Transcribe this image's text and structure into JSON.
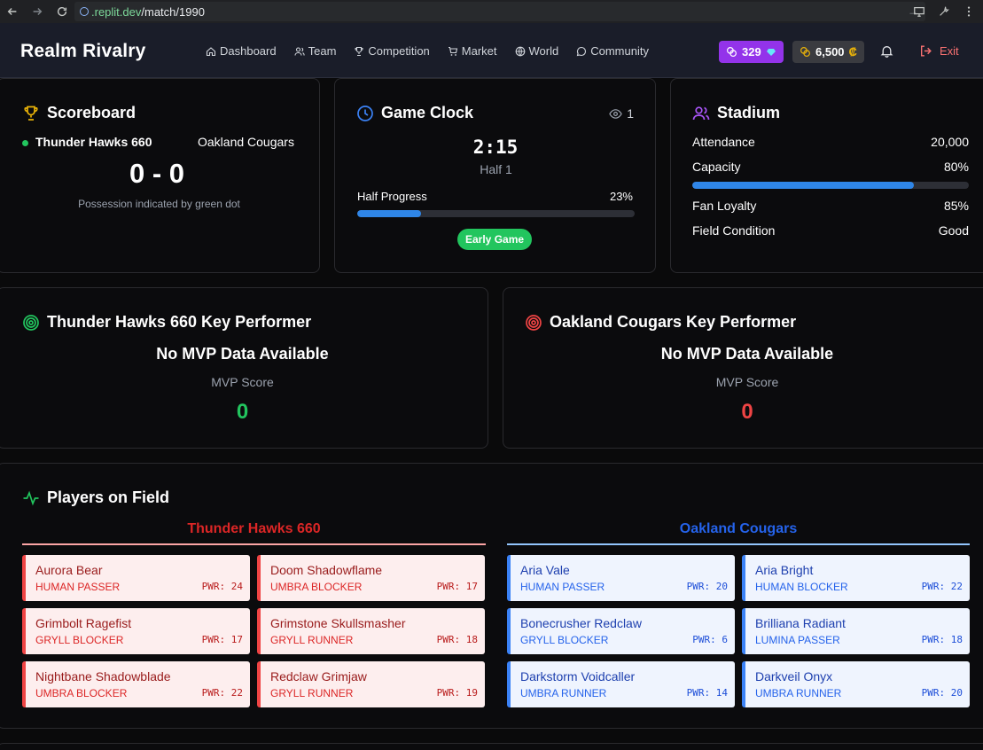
{
  "browser": {
    "url_host": ".replit.dev",
    "url_path": "/match/1990"
  },
  "header": {
    "brand": "Realm Rivalry",
    "nav": [
      "Dashboard",
      "Team",
      "Competition",
      "Market",
      "World",
      "Community"
    ],
    "gems": "329",
    "coins": "6,500",
    "exit_label": "Exit"
  },
  "scoreboard": {
    "title": "Scoreboard",
    "home_team": "Thunder Hawks 660",
    "away_team": "Oakland Cougars",
    "score": "0 - 0",
    "note": "Possession indicated by green dot"
  },
  "clock": {
    "title": "Game Clock",
    "viewers": "1",
    "time": "2:15",
    "half": "Half 1",
    "progress_label": "Half Progress",
    "progress_text": "23%",
    "progress_value": 0.23,
    "phase": "Early Game"
  },
  "stadium": {
    "title": "Stadium",
    "attendance_label": "Attendance",
    "attendance": "20,000",
    "capacity_label": "Capacity",
    "capacity": "80%",
    "capacity_value": 0.8,
    "loyalty_label": "Fan Loyalty",
    "loyalty": "85%",
    "field_label": "Field Condition",
    "field": "Good"
  },
  "performers": {
    "home_title": "Thunder Hawks 660 Key Performer",
    "away_title": "Oakland Cougars Key Performer",
    "none_text": "No MVP Data Available",
    "score_label": "MVP Score",
    "home_score": "0",
    "away_score": "0"
  },
  "field": {
    "title": "Players on Field",
    "home_name": "Thunder Hawks 660",
    "away_name": "Oakland Cougars",
    "home_players": [
      {
        "name": "Aurora Bear",
        "role": "HUMAN PASSER",
        "pwr": "PWR: 24"
      },
      {
        "name": "Doom Shadowflame",
        "role": "UMBRA BLOCKER",
        "pwr": "PWR: 17"
      },
      {
        "name": "Grimbolt Ragefist",
        "role": "GRYLL BLOCKER",
        "pwr": "PWR: 17"
      },
      {
        "name": "Grimstone Skullsmasher",
        "role": "GRYLL RUNNER",
        "pwr": "PWR: 18"
      },
      {
        "name": "Nightbane Shadowblade",
        "role": "UMBRA BLOCKER",
        "pwr": "PWR: 22"
      },
      {
        "name": "Redclaw Grimjaw",
        "role": "GRYLL RUNNER",
        "pwr": "PWR: 19"
      }
    ],
    "away_players": [
      {
        "name": "Aria Vale",
        "role": "HUMAN PASSER",
        "pwr": "PWR: 20"
      },
      {
        "name": "Aria Bright",
        "role": "HUMAN BLOCKER",
        "pwr": "PWR: 22"
      },
      {
        "name": "Bonecrusher Redclaw",
        "role": "GRYLL BLOCKER",
        "pwr": "PWR: 6"
      },
      {
        "name": "Brilliana Radiant",
        "role": "LUMINA PASSER",
        "pwr": "PWR: 18"
      },
      {
        "name": "Darkstorm Voidcaller",
        "role": "UMBRA RUNNER",
        "pwr": "PWR: 14"
      },
      {
        "name": "Darkveil Onyx",
        "role": "UMBRA RUNNER",
        "pwr": "PWR: 20"
      }
    ]
  },
  "colors": {
    "accent_green": "#22c55e",
    "accent_red": "#dc2626",
    "accent_blue": "#2563eb",
    "gem_purple": "#9333ea"
  }
}
